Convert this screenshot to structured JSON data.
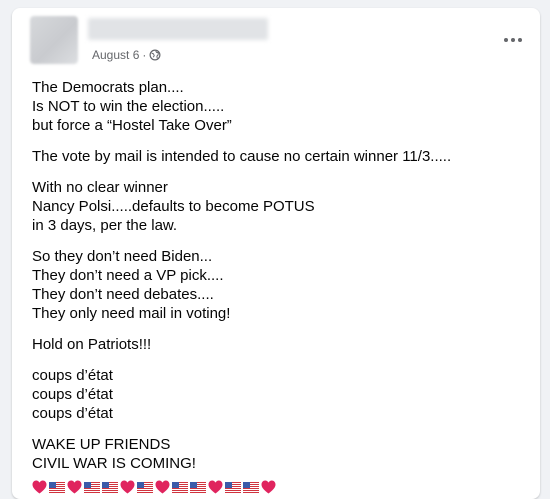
{
  "post": {
    "date": "August 6",
    "separator": " · ",
    "privacy_icon": "globe-icon",
    "more_icon": "more-options-icon",
    "paragraphs": [
      [
        "The Democrats plan....",
        "Is NOT to win the election.....",
        "but force a “Hostel Take Over”"
      ],
      [
        "The vote by mail is intended to cause no certain winner 11/3....."
      ],
      [
        "With no clear winner",
        "Nancy Polsi.....defaults to become POTUS",
        "in 3 days, per the law."
      ],
      [
        "So they don’t need Biden...",
        "They don’t need a VP pick....",
        "They don’t need debates....",
        "They only need mail in voting!"
      ],
      [
        "Hold on Patriots!!!"
      ],
      [
        "coups d’état",
        "coups d’état",
        "coups d’état"
      ],
      [
        "WAKE UP FRIENDS",
        "CIVIL WAR IS COMING!"
      ]
    ],
    "emoji_sequence": [
      "heart",
      "flag",
      "heart",
      "flag",
      "flag",
      "heart",
      "flag",
      "heart",
      "flag",
      "flag",
      "heart",
      "flag",
      "flag",
      "heart"
    ]
  },
  "colors": {
    "heart": "#e0245e",
    "flag_red": "#d0343f",
    "flag_blue": "#3b5ba9",
    "meta_text": "#65676b"
  }
}
